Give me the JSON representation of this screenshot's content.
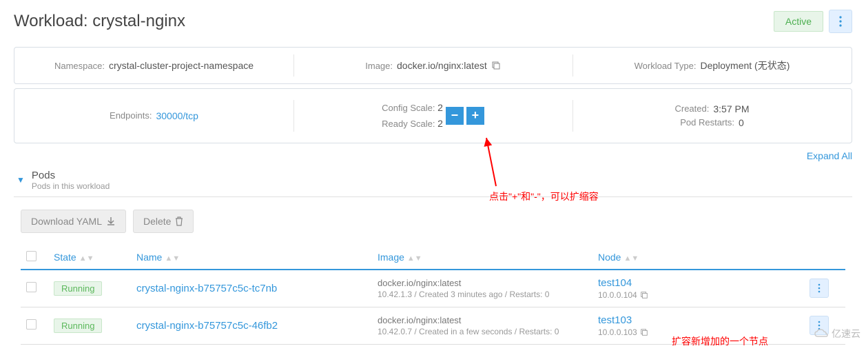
{
  "header": {
    "title": "Workload: crystal-nginx",
    "status": "Active"
  },
  "info1": {
    "namespace_label": "Namespace:",
    "namespace_value": "crystal-cluster-project-namespace",
    "image_label": "Image:",
    "image_value": "docker.io/nginx:latest",
    "type_label": "Workload Type:",
    "type_value": "Deployment (无状态)"
  },
  "info2": {
    "endpoints_label": "Endpoints:",
    "endpoints_value": "30000/tcp",
    "config_scale_label": "Config Scale:",
    "config_scale_value": "2",
    "ready_scale_label": "Ready Scale:",
    "ready_scale_value": "2",
    "created_label": "Created:",
    "created_value": "3:57 PM",
    "restarts_label": "Pod Restarts:",
    "restarts_value": "0"
  },
  "expand_all": "Expand All",
  "pods": {
    "title": "Pods",
    "subtitle": "Pods in this workload",
    "download_btn": "Download YAML",
    "delete_btn": "Delete",
    "columns": {
      "state": "State",
      "name": "Name",
      "image": "Image",
      "node": "Node"
    },
    "rows": [
      {
        "state": "Running",
        "name": "crystal-nginx-b75757c5c-tc7nb",
        "image": "docker.io/nginx:latest",
        "image_sub": "10.42.1.3 / Created 3 minutes ago / Restarts: 0",
        "node": "test104",
        "node_ip": "10.0.0.104"
      },
      {
        "state": "Running",
        "name": "crystal-nginx-b75757c5c-46fb2",
        "image": "docker.io/nginx:latest",
        "image_sub": "10.42.0.7 / Created in a few seconds / Restarts: 0",
        "node": "test103",
        "node_ip": "10.0.0.103"
      }
    ]
  },
  "annotations": {
    "scale_hint": "点击\"+\"和\"-\"，可以扩缩容",
    "new_node": "扩容新增加的一个节点"
  },
  "watermark": "亿速云"
}
